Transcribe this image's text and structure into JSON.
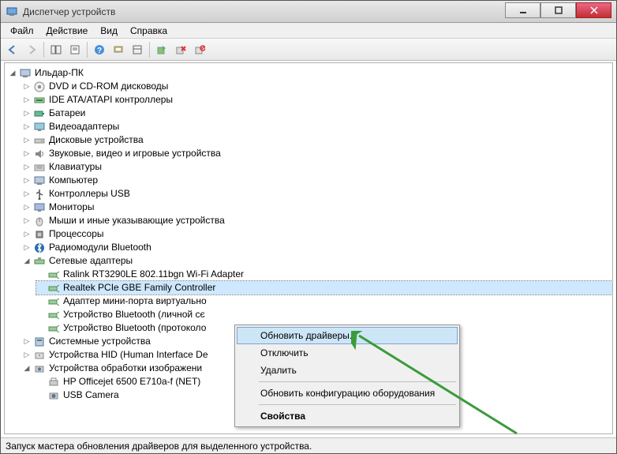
{
  "window": {
    "title": "Диспетчер устройств"
  },
  "menu": {
    "file": "Файл",
    "action": "Действие",
    "view": "Вид",
    "help": "Справка"
  },
  "tree": {
    "root": "Ильдар-ПК",
    "items": [
      "DVD и CD-ROM дисководы",
      "IDE ATA/ATAPI контроллеры",
      "Батареи",
      "Видеоадаптеры",
      "Дисковые устройства",
      "Звуковые, видео и игровые устройства",
      "Клавиатуры",
      "Компьютер",
      "Контроллеры USB",
      "Мониторы",
      "Мыши и иные указывающие устройства",
      "Процессоры",
      "Радиомодули Bluetooth",
      "Сетевые адаптеры",
      "Системные устройства",
      "Устройства HID (Human Interface De",
      "Устройства обработки изображени"
    ],
    "network": [
      "Ralink RT3290LE 802.11bgn Wi-Fi Adapter",
      "Realtek PCIe GBE Family Controller",
      "Адаптер мини-порта виртуально",
      "Устройство Bluetooth (личной сє",
      "Устройство Bluetooth (протоколо"
    ],
    "imaging": [
      "HP Officejet 6500 E710a-f (NET)",
      "USB Camera"
    ]
  },
  "context_menu": {
    "update": "Обновить драйверы...",
    "disable": "Отключить",
    "delete": "Удалить",
    "scan": "Обновить конфигурацию оборудования",
    "properties": "Свойства"
  },
  "statusbar": {
    "text": "Запуск мастера обновления драйверов для выделенного устройства."
  }
}
